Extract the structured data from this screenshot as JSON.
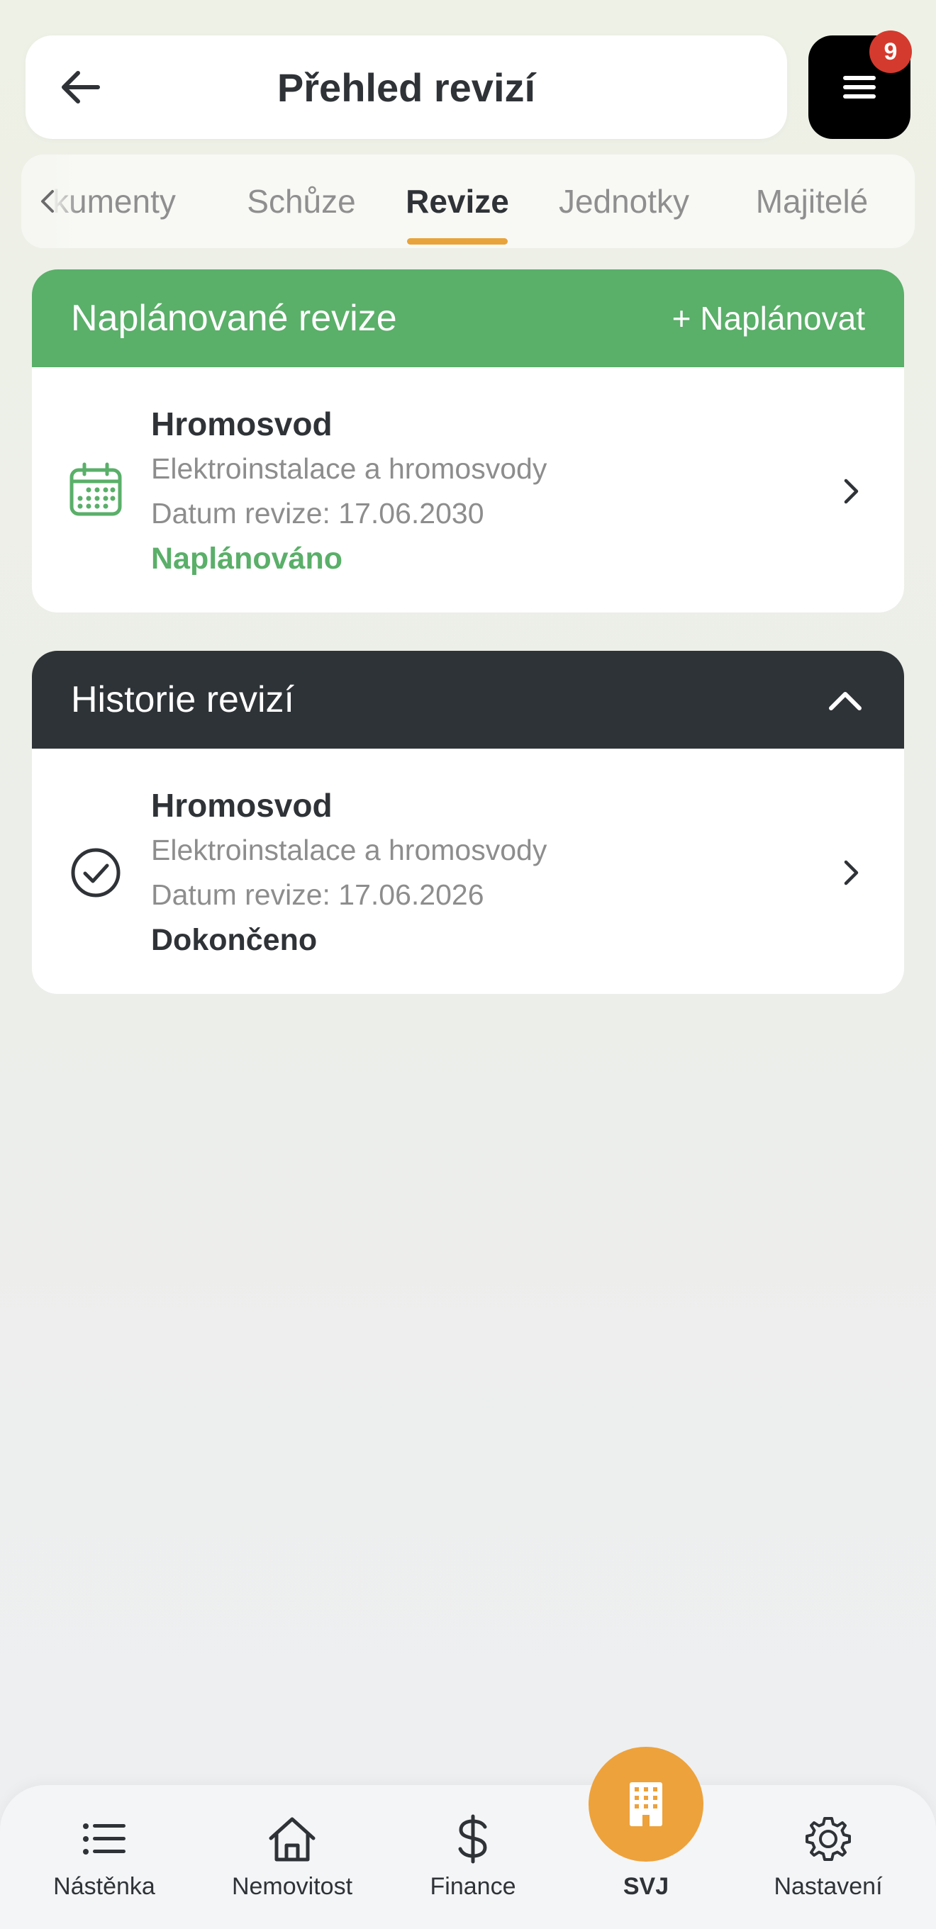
{
  "header": {
    "title": "Přehled revizí",
    "back_icon": "arrow-left-icon",
    "menu_icon": "hamburger-menu-icon",
    "menu_badge": "9"
  },
  "tabs": [
    {
      "label": "Dokumenty",
      "visible_text": "kumenty"
    },
    {
      "label": "Schůze"
    },
    {
      "label": "Revize",
      "active": true
    },
    {
      "label": "Jednotky"
    },
    {
      "label": "Majitelé"
    }
  ],
  "planned": {
    "title": "Naplánované revize",
    "action": "+ Naplánovat",
    "items": [
      {
        "icon": "calendar-icon",
        "title": "Hromosvod",
        "category": "Elektroinstalace a hromosvody",
        "date": "Datum revize: 17.06.2030",
        "status": "Naplánováno"
      }
    ]
  },
  "history": {
    "title": "Historie revizí",
    "toggle_icon": "chevron-up-icon",
    "items": [
      {
        "icon": "check-circle-icon",
        "title": "Hromosvod",
        "category": "Elektroinstalace a hromosvody",
        "date": "Datum revize: 17.06.2026",
        "status": "Dokončeno"
      }
    ]
  },
  "bottom_nav": {
    "items": [
      {
        "label": "Nástěnka",
        "icon": "list-icon"
      },
      {
        "label": "Nemovitost",
        "icon": "house-icon"
      },
      {
        "label": "Finance",
        "icon": "dollar-icon"
      },
      {
        "label": "SVJ",
        "icon": "building-icon"
      },
      {
        "label": "Nastavení",
        "icon": "gear-icon"
      }
    ]
  },
  "colors": {
    "accent_green": "#5aaf69",
    "dark_header": "#2e3337",
    "tab_underline": "#e8a33a",
    "fab": "#eda23c",
    "badge": "#d53a2e"
  }
}
